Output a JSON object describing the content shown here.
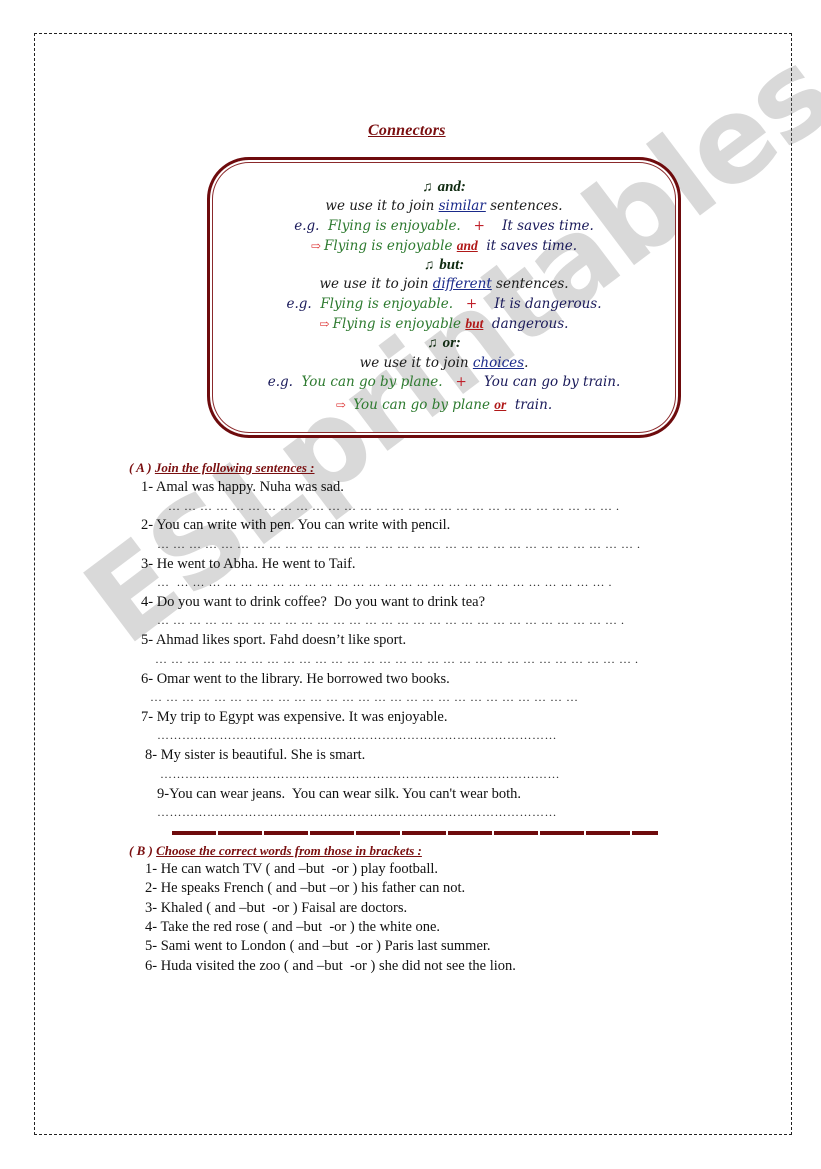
{
  "title": "Connectors",
  "box": {
    "and": {
      "heading_icon": "note-icon",
      "heading": "and:",
      "rule_prefix": "we use it to join ",
      "rule_keyword": "similar",
      "rule_suffix": " sentences.",
      "eg_label": "e.g.",
      "eg_sentence1": "Flying is enjoyable.",
      "plus": "+",
      "eg_sentence2": "It saves time.",
      "arrow": "⇨",
      "result_prefix": "Flying is enjoyable ",
      "result_keyword": "and",
      "result_suffix": "  it saves time."
    },
    "but": {
      "heading_icon": "note-icon",
      "heading": "but:",
      "rule_prefix": "we use it to join ",
      "rule_keyword": "different",
      "rule_suffix": " sentences.",
      "eg_label": "e.g.",
      "eg_sentence1": "Flying is enjoyable.",
      "plus": "+",
      "eg_sentence2": "It is dangerous.",
      "arrow": "⇨",
      "result_prefix": "Flying is enjoyable ",
      "result_keyword": "but",
      "result_suffix": "  dangerous."
    },
    "or": {
      "heading_icon": "note-icon",
      "heading": "or:",
      "rule_prefix": "we use it to join ",
      "rule_keyword": "choices",
      "rule_suffix": ".",
      "eg_label": "e.g.",
      "eg_sentence1": "You can go by plane.",
      "plus": "+",
      "eg_sentence2": "You can go by train.",
      "arrow": "⇨",
      "result_prefix": "You can go by plane ",
      "result_keyword": "or",
      "result_suffix": "  train."
    }
  },
  "section_a": {
    "label": "( A )",
    "instruction": "Join the following sentences :",
    "items": [
      "1- Amal was happy. Nuha was sad.",
      "2- You can write with pen. You can write with pencil.",
      "3- He went to Abha. He went to Taif.",
      "4- Do you want to drink coffee?  Do you want to drink tea?",
      "5- Ahmad likes sport. Fahd doesn’t like sport.",
      "6- Omar went to the library. He borrowed two books.",
      "7- My trip to Egypt was expensive. It was enjoyable.",
      "8- My sister is beautiful. She is smart.",
      "9-You can wear jeans.  You can wear silk. You can't wear both."
    ],
    "answer_lines": [
      "… … … … … … … … … … … … … … … … … … … … … … … … … … … … .",
      "… … … … … … … … … … … … … … … … … … … … … … … … … … … … … … .",
      "…  … … … … … … … … … … … … … … … … … … … … … … … … … … … .",
      "… … … … … … … … … … … … … … … … … … … … … … … … … … … … … .",
      "… … … … … … … … … … … … … … … … … … … … … … … … … … … … … … .",
      "… … … … … … … … … … … … … … … … … … … … … … … … … … …",
      "……………………………………………………………………………………",
      "……………………………………………………………………………………",
      "……………………………………………………………………………………"
    ]
  },
  "section_b": {
    "label": "(  B  )",
    "instruction": "Choose the correct words from those in brackets :",
    "items": [
      "1- He can watch TV ( and –but  -or ) play football.",
      "2- He speaks French ( and –but –or ) his father can not.",
      "3- Khaled ( and –but  -or ) Faisal are doctors.",
      "4- Take the red rose ( and –but  -or ) the white one.",
      "5- Sami went to London ( and –but  -or ) Paris last summer.",
      "6- Huda visited the zoo ( and –but  -or ) she did not see the lion."
    ]
  },
  "watermark": "ESLprintables.com"
}
